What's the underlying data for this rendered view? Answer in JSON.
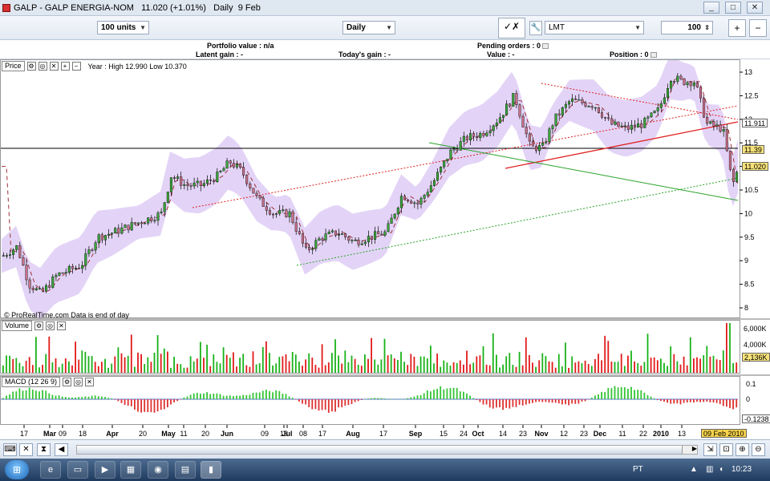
{
  "window": {
    "title": "GALP - GALP ENERGIA-NOM   11.020 (+1.01%)   Daily  9 Feb",
    "min": "_",
    "max": "□",
    "close": "✕"
  },
  "toolbar": {
    "units": "100 units",
    "period": "Daily",
    "order_type": "LMT",
    "quantity": "100"
  },
  "info": {
    "portfolio_value": "Portfolio value : n/a",
    "latent_gain": "Latent gain : -",
    "todays_gain": "Today's gain : -",
    "pending_orders": "Pending orders : 0",
    "value": "Value : -",
    "position": "Position : 0"
  },
  "price_panel": {
    "label": "Price",
    "year_info": "Year : High 12.990 Low 10.370",
    "footer": "© ProRealTime.com  Data is end of day",
    "y_ticks": [
      "13",
      "12.5",
      "12",
      "11.5",
      "11",
      "10.5",
      "10",
      "9.5",
      "9",
      "8.5",
      "8"
    ],
    "tag_upper_band": "11.911",
    "tag_hline": "11.39",
    "tag_last": "11.020"
  },
  "volume_panel": {
    "label": "Volume",
    "y_ticks": [
      "6,000K",
      "4,000K",
      "2,000K"
    ],
    "tag_last": "2,136K"
  },
  "macd_panel": {
    "label": "MACD (12 26 9)",
    "y_ticks": [
      "0.1",
      "0",
      "-0.1"
    ],
    "tag_last": "-0.1238"
  },
  "x_axis": {
    "labels": [
      "17",
      "Mar",
      "09",
      "18",
      "Apr",
      "20",
      "May",
      "11",
      "20",
      "Jun",
      "09",
      "18",
      "Jul",
      "08",
      "17",
      "Aug",
      "17",
      "Sep",
      "15",
      "24",
      "Oct",
      "14",
      "23",
      "Nov",
      "12",
      "23",
      "Dec",
      "11",
      "22",
      "2010",
      "13"
    ],
    "date_tag": "09 Feb 2010"
  },
  "colors": {
    "up": "#19b219",
    "down": "#e21a1a",
    "candle_up_body": "#3aa63a",
    "candle_down_body": "#c9718a",
    "band_fill": "#e3d4f7",
    "macd_pos": "#34c434",
    "macd_neg": "#de3030"
  },
  "taskbar": {
    "lang": "PT",
    "clock": "10:23"
  }
}
